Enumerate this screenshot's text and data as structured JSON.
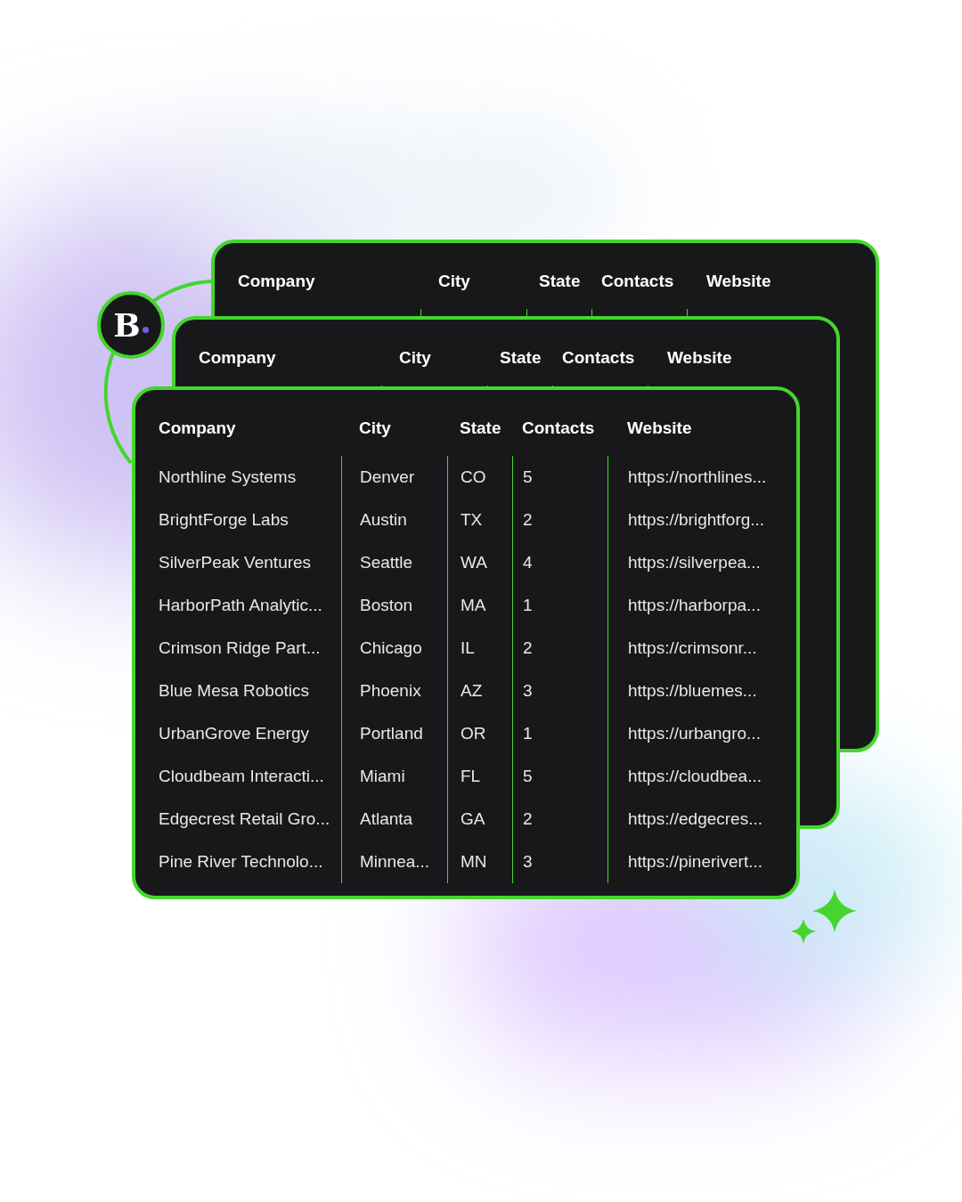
{
  "logo": {
    "letter": "B"
  },
  "cards": [
    {
      "columns": [
        "Company",
        "City",
        "State",
        "Contacts",
        "Website"
      ]
    },
    {
      "columns": [
        "Company",
        "City",
        "State",
        "Contacts",
        "Website"
      ]
    },
    {
      "columns": [
        "Company",
        "City",
        "State",
        "Contacts",
        "Website"
      ],
      "rows": [
        [
          "Northline Systems",
          "Denver",
          "CO",
          "5",
          "https://northlines..."
        ],
        [
          "BrightForge Labs",
          "Austin",
          "TX",
          "2",
          "https://brightforg..."
        ],
        [
          "SilverPeak Ventures",
          "Seattle",
          "WA",
          "4",
          "https://silverpea..."
        ],
        [
          "HarborPath Analytic...",
          "Boston",
          "MA",
          "1",
          "https://harborpa..."
        ],
        [
          "Crimson Ridge Part...",
          "Chicago",
          "IL",
          "2",
          "https://crimsonr..."
        ],
        [
          "Blue Mesa Robotics",
          "Phoenix",
          "AZ",
          "3",
          "https://bluemes..."
        ],
        [
          "UrbanGrove Energy",
          "Portland",
          "OR",
          "1",
          "https://urbangro..."
        ],
        [
          "Cloudbeam Interacti...",
          "Miami",
          "FL",
          "5",
          "https://cloudbea..."
        ],
        [
          "Edgecrest Retail Gro...",
          "Atlanta",
          "GA",
          "2",
          "https://edgecres..."
        ],
        [
          "Pine River Technolo...",
          "Minnea...",
          "MN",
          "3",
          "https://pinerivert..."
        ]
      ]
    }
  ]
}
